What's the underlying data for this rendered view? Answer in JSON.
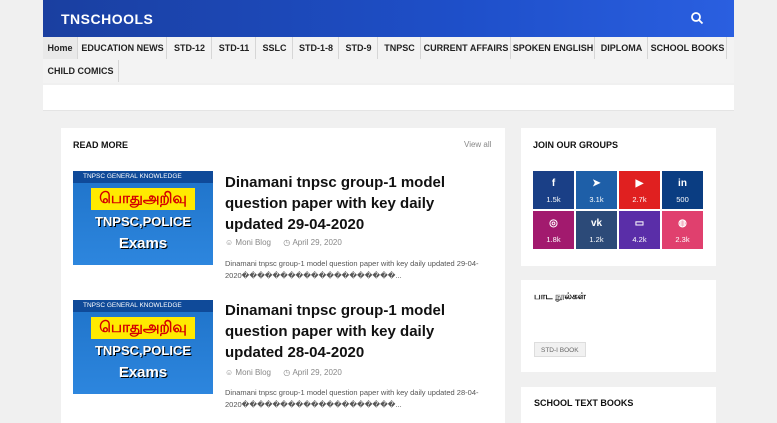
{
  "header": {
    "logo": "TNSCHOOLS",
    "search_icon": "search-icon"
  },
  "nav": {
    "items": [
      "Home",
      "EDUCATION NEWS",
      "STD-12",
      "STD-11",
      "SSLC",
      "STD-1-8",
      "STD-9",
      "TNPSC",
      "CURRENT AFFAIRS",
      "SPOKEN ENGLISH",
      "DIPLOMA",
      "SCHOOL BOOKS",
      "CHILD COMICS"
    ]
  },
  "main": {
    "title": "READ MORE",
    "view_all": "View all",
    "thumb": {
      "top": "TNPSC GENERAL KNOWLEDGE",
      "tamil": "பொதுஅறிவு",
      "line1": "TNPSC,POLICE",
      "line2": "Exams"
    },
    "posts": [
      {
        "title": "Dinamani tnpsc group-1 model question paper with key daily updated 29-04-2020",
        "author": "Moni Blog",
        "date": "April 29, 2020",
        "snippet": "Dinamani tnpsc group-1 model question paper with key daily updated 29-04-2020��������������������..."
      },
      {
        "title": "Dinamani tnpsc group-1 model question paper with key daily updated 28-04-2020",
        "author": "Moni Blog",
        "date": "April 29, 2020",
        "snippet": "Dinamani tnpsc group-1 model question paper with key daily updated 28-04-2020��������������������..."
      }
    ]
  },
  "sidebar": {
    "groups_title": "JOIN OUR GROUPS",
    "social": [
      {
        "icon": "facebook-icon",
        "glyph": "f",
        "count": "1.5k",
        "color": "#1a3f86"
      },
      {
        "icon": "telegram-icon",
        "glyph": "➤",
        "count": "3.1k",
        "color": "#1e5fa8"
      },
      {
        "icon": "youtube-icon",
        "glyph": "▶",
        "count": "2.7k",
        "color": "#e02020"
      },
      {
        "icon": "linkedin-icon",
        "glyph": "in",
        "count": "500",
        "color": "#0a3d82"
      },
      {
        "icon": "instagram-icon",
        "glyph": "◎",
        "count": "1.8k",
        "color": "#a21a6e"
      },
      {
        "icon": "vk-icon",
        "glyph": "vk",
        "count": "1.2k",
        "color": "#2c4a78"
      },
      {
        "icon": "twitch-icon",
        "glyph": "▭",
        "count": "4.2k",
        "color": "#5a2ea8"
      },
      {
        "icon": "dribbble-icon",
        "glyph": "◍",
        "count": "2.3k",
        "color": "#e0406e"
      }
    ],
    "lessons_title": "பாட நூல்கள்",
    "lessons_tag": "STD-I BOOK",
    "books_title": "SCHOOL TEXT BOOKS"
  }
}
